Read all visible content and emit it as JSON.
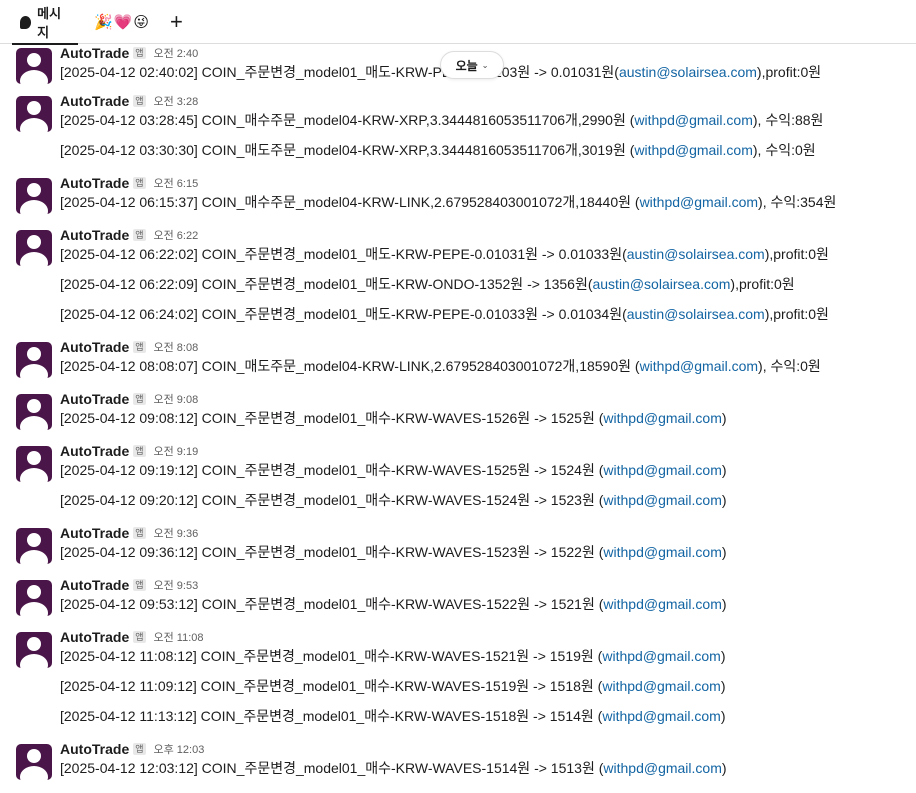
{
  "tabs": {
    "messages_label": "메시지",
    "emoji_tab": "🎉💗😜",
    "add_label": "+"
  },
  "date_divider": {
    "label": "오늘",
    "chevron": "⌄"
  },
  "sender": "AutoTrade",
  "app_badge": "앱",
  "groups": [
    {
      "time": "오전 2:40",
      "messages": [
        {
          "text": "[2025-04-12 02:40:02] COIN_주문변경_model01_매도-KRW-PEPE-0.0103원 -> 0.01031원(",
          "email": "austin@solairsea.com",
          "suffix": "),profit:0원"
        }
      ]
    },
    {
      "time": "오전 3:28",
      "messages": [
        {
          "text": "[2025-04-12 03:28:45] COIN_매수주문_model04-KRW-XRP,3.3444816053511706개,2990원 (",
          "email": "withpd@gmail.com",
          "suffix": "), 수익:88원"
        },
        {
          "text": "[2025-04-12 03:30:30] COIN_매도주문_model04-KRW-XRP,3.3444816053511706개,3019원 (",
          "email": "withpd@gmail.com",
          "suffix": "), 수익:0원"
        }
      ]
    },
    {
      "time": "오전 6:15",
      "messages": [
        {
          "text": "[2025-04-12 06:15:37] COIN_매수주문_model04-KRW-LINK,2.679528403001072개,18440원 (",
          "email": "withpd@gmail.com",
          "suffix": "), 수익:354원"
        }
      ]
    },
    {
      "time": "오전 6:22",
      "messages": [
        {
          "text": "[2025-04-12 06:22:02] COIN_주문변경_model01_매도-KRW-PEPE-0.01031원 -> 0.01033원(",
          "email": "austin@solairsea.com",
          "suffix": "),profit:0원"
        },
        {
          "text": "[2025-04-12 06:22:09] COIN_주문변경_model01_매도-KRW-ONDO-1352원 -> 1356원(",
          "email": "austin@solairsea.com",
          "suffix": "),profit:0원"
        },
        {
          "text": "[2025-04-12 06:24:02] COIN_주문변경_model01_매도-KRW-PEPE-0.01033원 -> 0.01034원(",
          "email": "austin@solairsea.com",
          "suffix": "),profit:0원"
        }
      ]
    },
    {
      "time": "오전 8:08",
      "messages": [
        {
          "text": "[2025-04-12 08:08:07] COIN_매도주문_model04-KRW-LINK,2.679528403001072개,18590원 (",
          "email": "withpd@gmail.com",
          "suffix": "), 수익:0원"
        }
      ]
    },
    {
      "time": "오전 9:08",
      "messages": [
        {
          "text": "[2025-04-12 09:08:12] COIN_주문변경_model01_매수-KRW-WAVES-1526원 -> 1525원 (",
          "email": "withpd@gmail.com",
          "suffix": ")"
        }
      ]
    },
    {
      "time": "오전 9:19",
      "messages": [
        {
          "text": "[2025-04-12 09:19:12] COIN_주문변경_model01_매수-KRW-WAVES-1525원 -> 1524원 (",
          "email": "withpd@gmail.com",
          "suffix": ")"
        },
        {
          "text": "[2025-04-12 09:20:12] COIN_주문변경_model01_매수-KRW-WAVES-1524원 -> 1523원 (",
          "email": "withpd@gmail.com",
          "suffix": ")"
        }
      ]
    },
    {
      "time": "오전 9:36",
      "messages": [
        {
          "text": "[2025-04-12 09:36:12] COIN_주문변경_model01_매수-KRW-WAVES-1523원 -> 1522원 (",
          "email": "withpd@gmail.com",
          "suffix": ")"
        }
      ]
    },
    {
      "time": "오전 9:53",
      "messages": [
        {
          "text": "[2025-04-12 09:53:12] COIN_주문변경_model01_매수-KRW-WAVES-1522원 -> 1521원 (",
          "email": "withpd@gmail.com",
          "suffix": ")"
        }
      ]
    },
    {
      "time": "오전 11:08",
      "messages": [
        {
          "text": "[2025-04-12 11:08:12] COIN_주문변경_model01_매수-KRW-WAVES-1521원 -> 1519원 (",
          "email": "withpd@gmail.com",
          "suffix": ")"
        },
        {
          "text": "[2025-04-12 11:09:12] COIN_주문변경_model01_매수-KRW-WAVES-1519원 -> 1518원 (",
          "email": "withpd@gmail.com",
          "suffix": ")"
        },
        {
          "text": "[2025-04-12 11:13:12] COIN_주문변경_model01_매수-KRW-WAVES-1518원 -> 1514원 (",
          "email": "withpd@gmail.com",
          "suffix": ")"
        }
      ]
    },
    {
      "time": "오후 12:03",
      "messages": [
        {
          "text": "[2025-04-12 12:03:12] COIN_주문변경_model01_매수-KRW-WAVES-1514원 -> 1513원 (",
          "email": "withpd@gmail.com",
          "suffix": ")"
        }
      ]
    }
  ]
}
